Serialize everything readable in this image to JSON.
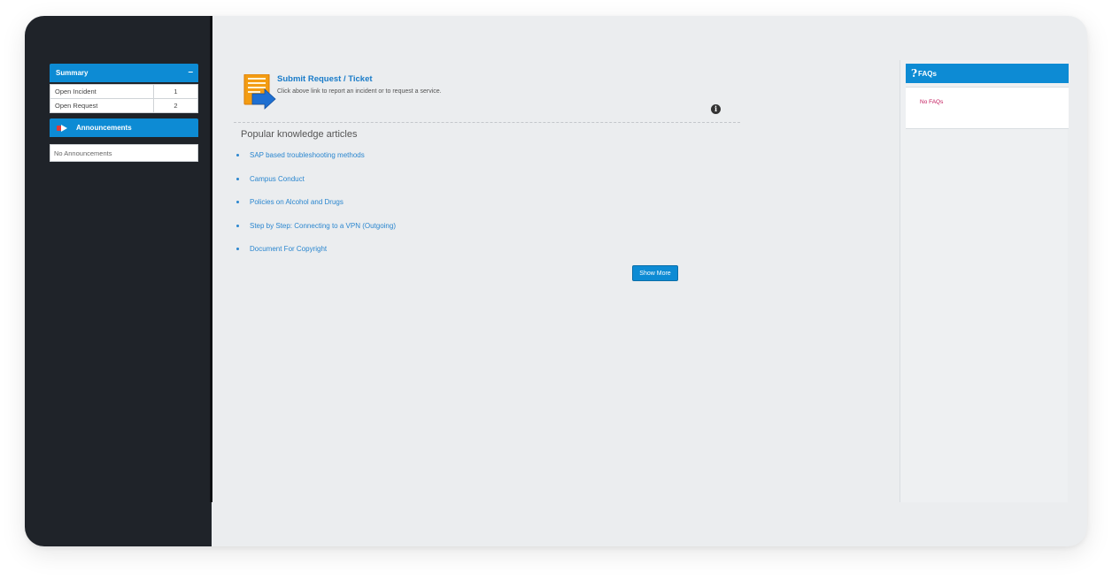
{
  "sidebar": {
    "summary": {
      "title": "Summary",
      "collapse_symbol": "–",
      "rows": [
        {
          "label": "Open Incident",
          "count": "1"
        },
        {
          "label": "Open Request",
          "count": "2"
        }
      ]
    },
    "announcements": {
      "title": "Announcements",
      "icon": "megaphone-icon",
      "empty_text": "No Announcements"
    }
  },
  "main": {
    "submit": {
      "link": "Submit Request / Ticket",
      "description": "Click above link to report an incident or to request a service.",
      "icon": "ticket-form-icon"
    },
    "info_icon": "i",
    "knowledge": {
      "title": "Popular knowledge articles",
      "articles": [
        "SAP based troubleshooting methods",
        "Campus Conduct",
        "Policies on Alcohol and Drugs",
        "Step by Step: Connecting to a VPN (Outgoing)",
        "Document For Copyright"
      ],
      "show_more": "Show More"
    }
  },
  "faq": {
    "title": "FAQs",
    "icon_glyph": "?",
    "empty_text": "No FAQs"
  },
  "colors": {
    "sidebar_bg": "#1f2329",
    "accent": "#0d8bd4",
    "link": "#2a86cf",
    "faq_empty": "#c2185b"
  }
}
